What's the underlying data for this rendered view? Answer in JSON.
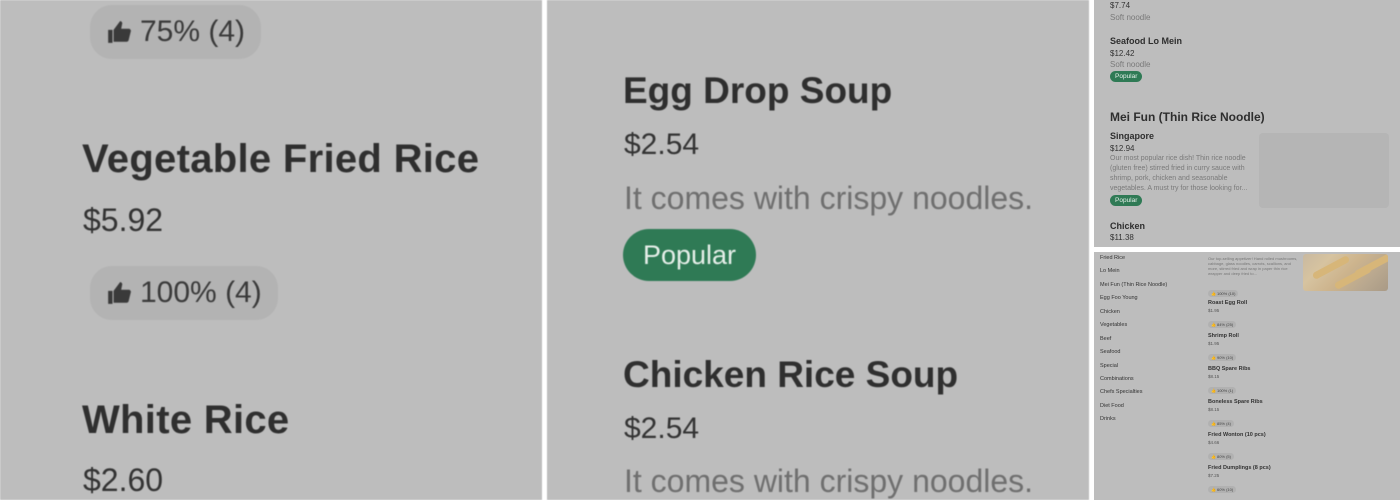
{
  "panel1": {
    "top_rating": "75% (4)",
    "items": [
      {
        "name": "Vegetable Fried Rice",
        "price": "$5.92",
        "rating": "100% (4)"
      },
      {
        "name": "White Rice",
        "price": "$2.60"
      }
    ]
  },
  "panel2": {
    "items": [
      {
        "name": "Egg Drop Soup",
        "price": "$2.54",
        "description": "It comes with crispy noodles.",
        "badge": "Popular"
      },
      {
        "name": "Chicken Rice Soup",
        "price": "$2.54",
        "description": "It comes with crispy noodles."
      }
    ]
  },
  "panel3": {
    "top_price": "$7.74",
    "top_desc": "Soft noodle",
    "seafood": {
      "name": "Seafood Lo Mein",
      "price": "$12.42",
      "desc": "Soft noodle",
      "badge": "Popular"
    },
    "section_title": "Mei Fun (Thin Rice Noodle)",
    "singapore": {
      "name": "Singapore",
      "price": "$12.94",
      "desc": "Our most popular rice dish! Thin rice noodle (gluten free) stirred fried in curry sauce with shrimp, pork, chicken and seasonable vegetables. A must try for those looking for...",
      "badge": "Popular"
    },
    "chicken": {
      "name": "Chicken",
      "price": "$11.38"
    }
  },
  "panel4": {
    "nav": [
      "Fried Rice",
      "Lo Mein",
      "Mei Fun (Thin Rice Noodle)",
      "Egg Foo Young",
      "Chicken",
      "Vegetables",
      "Beef",
      "Seafood",
      "Special",
      "Combinations",
      "Chefs Specialties",
      "Diet Food",
      "Drinks"
    ],
    "top_desc": "Our top-selling appetizer! Hand rolled mushrooms, cabbage, glass noodles, carrots, scallions, and more, stirred fried and wrap in paper thin rice wrapper and deep fried to...",
    "top_rating": "100% (10)",
    "items": [
      {
        "name": "Roast Egg Roll",
        "price": "$1.95",
        "rating": "84% (25)"
      },
      {
        "name": "Shrimp Roll",
        "price": "$1.95",
        "rating": "90% (10)"
      },
      {
        "name": "BBQ Spare Ribs",
        "price": "$8.15",
        "rating": "100% (1)"
      },
      {
        "name": "Boneless Spare Ribs",
        "price": "$8.15",
        "rating": "85% (4)"
      },
      {
        "name": "Fried Wonton (10 pcs)",
        "price": "$4.66",
        "rating": "80% (5)"
      },
      {
        "name": "Fried Dumplings (8 pcs)",
        "price": "$7.25",
        "rating": "60% (10)"
      }
    ]
  }
}
